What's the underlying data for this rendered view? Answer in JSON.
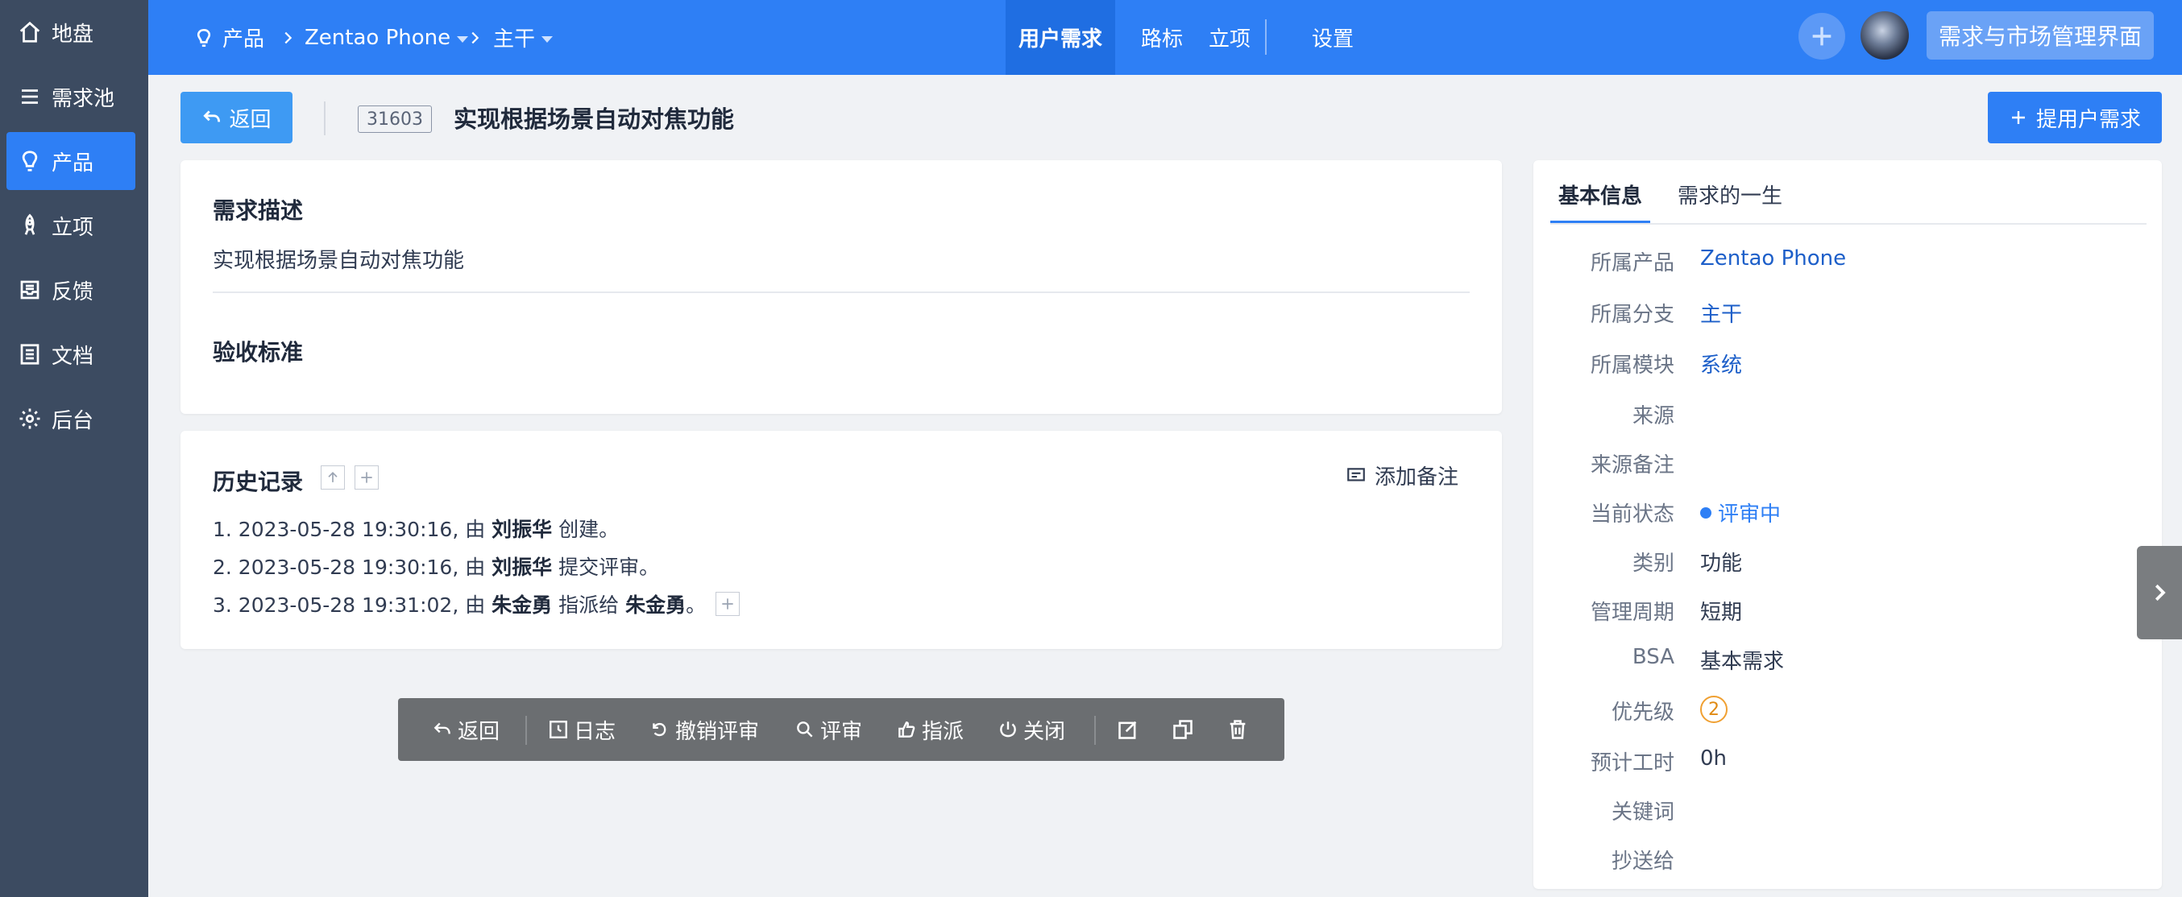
{
  "sidebar": {
    "items": [
      {
        "label": "地盘",
        "icon": "home-icon"
      },
      {
        "label": "需求池",
        "icon": "list-icon"
      },
      {
        "label": "产品",
        "icon": "lightbulb-icon",
        "active": true
      },
      {
        "label": "立项",
        "icon": "rocket-icon"
      },
      {
        "label": "反馈",
        "icon": "inbox-icon"
      },
      {
        "label": "文档",
        "icon": "document-icon"
      },
      {
        "label": "后台",
        "icon": "gear-icon"
      }
    ]
  },
  "header": {
    "crumb_product": "产品",
    "crumb_name": "Zentao Phone",
    "crumb_branch": "主干",
    "nav": [
      "用户需求",
      "路标",
      "立项",
      "设置"
    ],
    "active_nav": "用户需求",
    "mgmt_button": "需求与市场管理界面"
  },
  "toolbar": {
    "back_label": "返回",
    "story_id": "31603",
    "story_title": "实现根据场景自动对焦功能",
    "propose_label": "提用户需求"
  },
  "desc_card": {
    "desc_title": "需求描述",
    "desc_text": "实现根据场景自动对焦功能",
    "accept_title": "验收标准"
  },
  "history": {
    "title": "历史记录",
    "add_note": "添加备注",
    "entries": [
      {
        "prefix": "1. 2023-05-28 19:30:16, 由 ",
        "actor": "刘振华",
        "action": " 创建。",
        "target": ""
      },
      {
        "prefix": "2. 2023-05-28 19:30:16, 由 ",
        "actor": "刘振华",
        "action": " 提交评审。",
        "target": ""
      },
      {
        "prefix": "3. 2023-05-28 19:31:02, 由 ",
        "actor": "朱金勇",
        "action": " 指派给 ",
        "target": "朱金勇",
        "suffix": "。"
      }
    ]
  },
  "actions": {
    "back": "返回",
    "log": "日志",
    "revoke": "撤销评审",
    "review": "评审",
    "assign": "指派",
    "close": "关闭"
  },
  "info_panel": {
    "tabs": [
      "基本信息",
      "需求的一生"
    ],
    "fields": [
      {
        "key": "所属产品",
        "value": "Zentao Phone",
        "style": "link"
      },
      {
        "key": "所属分支",
        "value": "主干",
        "style": "link"
      },
      {
        "key": "所属模块",
        "value": "系统",
        "style": "link"
      },
      {
        "key": "来源",
        "value": ""
      },
      {
        "key": "来源备注",
        "value": ""
      },
      {
        "key": "当前状态",
        "value": "评审中",
        "style": "status"
      },
      {
        "key": "类别",
        "value": "功能"
      },
      {
        "key": "管理周期",
        "value": "短期"
      },
      {
        "key": "BSA",
        "value": "基本需求"
      },
      {
        "key": "优先级",
        "value": "2",
        "style": "priority"
      },
      {
        "key": "预计工时",
        "value": "0h"
      },
      {
        "key": "关键词",
        "value": ""
      },
      {
        "key": "抄送给",
        "value": ""
      }
    ]
  },
  "colors": {
    "primary": "#2e7ff5",
    "sidebar": "#3c4b61",
    "action_bar": "#6b6e71",
    "priority": "#f0a032"
  }
}
